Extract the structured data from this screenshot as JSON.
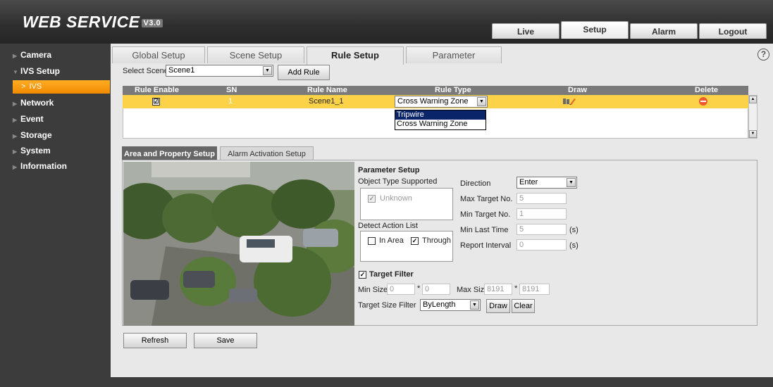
{
  "header": {
    "title": "WEB  SERVICE",
    "version": "V3.0",
    "tabs": [
      {
        "label": "Live"
      },
      {
        "label": "Setup"
      },
      {
        "label": "Alarm"
      },
      {
        "label": "Logout"
      }
    ]
  },
  "sidebar": {
    "items": [
      {
        "label": "Camera"
      },
      {
        "label": "IVS Setup"
      },
      {
        "label": "Network"
      },
      {
        "label": "Event"
      },
      {
        "label": "Storage"
      },
      {
        "label": "System"
      },
      {
        "label": "Information"
      }
    ],
    "active_sub": "IVS"
  },
  "subtabs": [
    {
      "label": "Global Setup"
    },
    {
      "label": "Scene Setup"
    },
    {
      "label": "Rule Setup"
    },
    {
      "label": "Parameter"
    }
  ],
  "scene": {
    "label": "Select Scene",
    "value": "Scene1",
    "add_rule": "Add Rule"
  },
  "rules_table": {
    "headers": [
      "Rule Enable",
      "SN",
      "Rule Name",
      "Rule Type",
      "Draw",
      "Delete"
    ],
    "rows": [
      {
        "enabled": "☑",
        "sn": "1",
        "name": "Scene1_1",
        "type": "Cross Warning Zone"
      }
    ],
    "type_options": [
      "Tripwire",
      "Cross Warning Zone"
    ]
  },
  "inner_tabs": [
    "Area and Property Setup",
    "Alarm Activation Setup"
  ],
  "params": {
    "title": "Parameter Setup",
    "object_type_label": "Object Type Supported",
    "object_unknown": "Unknown",
    "detect_action_label": "Detect Action List",
    "in_area": "In Area",
    "through": "Through",
    "direction_label": "Direction",
    "direction_value": "Enter",
    "max_target_label": "Max Target No.",
    "max_target_value": "5",
    "min_target_label": "Min Target No.",
    "min_target_value": "1",
    "min_last_time_label": "Min Last Time",
    "min_last_time_value": "5",
    "report_interval_label": "Report Interval",
    "report_interval_value": "0",
    "unit_s": "(s)",
    "target_filter_label": "Target Filter",
    "min_size_label": "Min Size",
    "min_size_w": "0",
    "min_size_h": "0",
    "times": "*",
    "max_size_label": "Max Size",
    "max_size_w": "8191",
    "max_size_h": "8191",
    "target_size_filter_label": "Target Size Filter",
    "target_size_filter_value": "ByLength",
    "draw": "Draw",
    "clear": "Clear"
  },
  "actions": {
    "refresh": "Refresh",
    "save": "Save"
  }
}
